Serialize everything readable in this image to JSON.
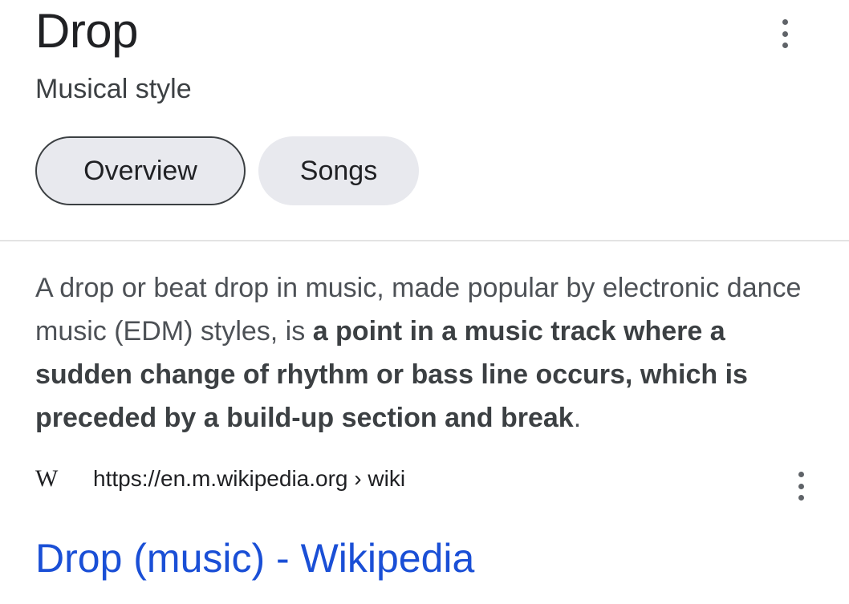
{
  "panel": {
    "title": "Drop",
    "subtitle": "Musical style",
    "tabs": [
      {
        "label": "Overview",
        "selected": true
      },
      {
        "label": "Songs",
        "selected": false
      }
    ]
  },
  "description": {
    "text_before": "A drop or beat drop in music, made popular by electronic dance music (EDM) styles, is ",
    "text_bold": "a point in a music track where a sudden change of rhythm or bass line occurs, which is preceded by a build-up section and break",
    "text_after": "."
  },
  "result": {
    "source_icon": "W",
    "source_icon_name": "wikipedia-icon",
    "url": "https://en.m.wikipedia.org › wiki",
    "title": "Drop (music) - Wikipedia"
  },
  "colors": {
    "link": "#1a4fd6",
    "chip_bg": "#e8e9ee"
  }
}
